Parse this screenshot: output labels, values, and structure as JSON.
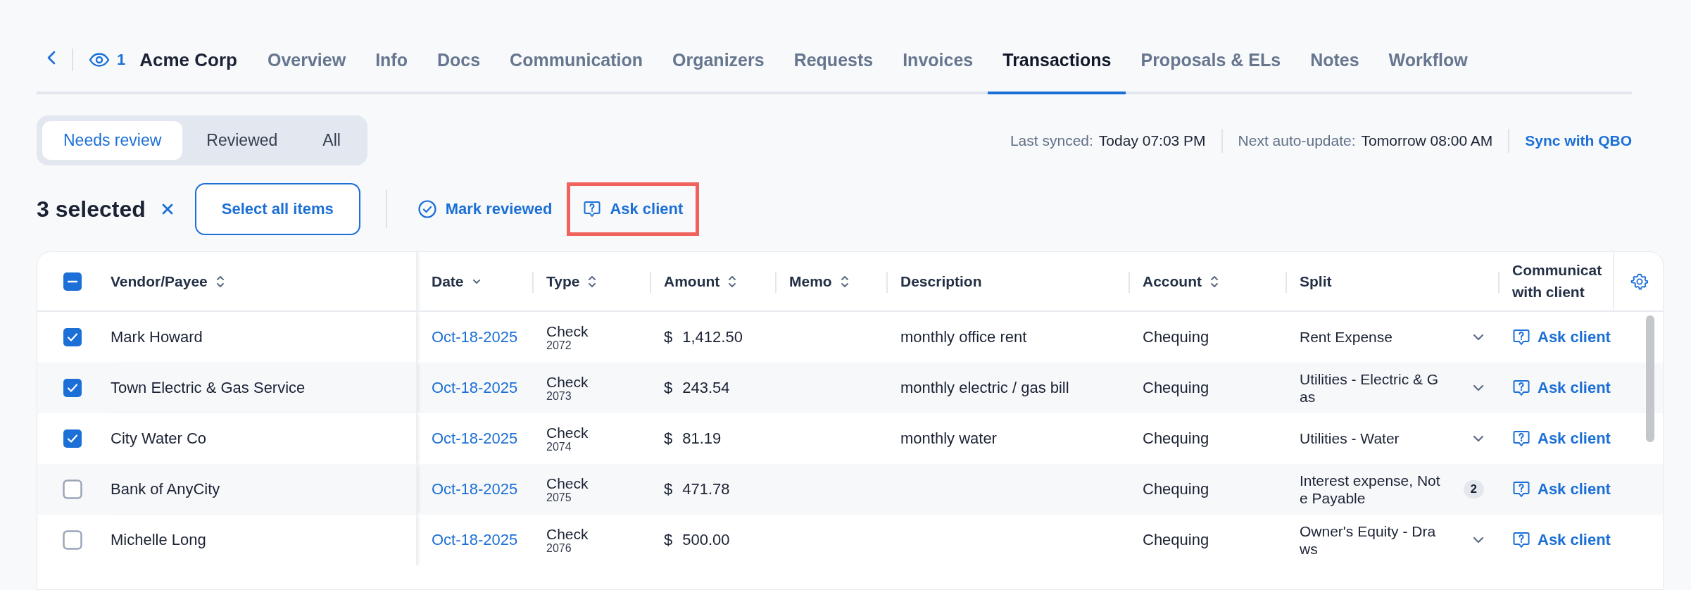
{
  "header": {
    "viewers": "1",
    "client_name": "Acme Corp"
  },
  "tabs": [
    {
      "label": "Overview",
      "selected": false
    },
    {
      "label": "Info",
      "selected": false
    },
    {
      "label": "Docs",
      "selected": false
    },
    {
      "label": "Communication",
      "selected": false
    },
    {
      "label": "Organizers",
      "selected": false
    },
    {
      "label": "Requests",
      "selected": false
    },
    {
      "label": "Invoices",
      "selected": false
    },
    {
      "label": "Transactions",
      "selected": true
    },
    {
      "label": "Proposals & ELs",
      "selected": false
    },
    {
      "label": "Notes",
      "selected": false
    },
    {
      "label": "Workflow",
      "selected": false
    }
  ],
  "filter": [
    {
      "label": "Needs review",
      "selected": true
    },
    {
      "label": "Reviewed",
      "selected": false
    },
    {
      "label": "All",
      "selected": false
    }
  ],
  "sync": {
    "last_label": "Last synced:",
    "last_value": "Today 07:03 PM",
    "next_label": "Next auto-update:",
    "next_value": "Tomorrow 08:00 AM",
    "action": "Sync with QBO"
  },
  "bulk": {
    "count_text": "3 selected",
    "select_all": "Select all items",
    "mark_reviewed": "Mark reviewed",
    "ask_client": "Ask client",
    "ask_client_highlighted": true
  },
  "table": {
    "header_checkbox_indeterminate": true,
    "columns": [
      {
        "label": "Vendor/Payee",
        "sortable": true,
        "sorted": false
      },
      {
        "label": "Date",
        "sortable": true,
        "sorted": true
      },
      {
        "label": "Type",
        "sortable": true,
        "sorted": false
      },
      {
        "label": "Amount",
        "sortable": true,
        "sorted": false
      },
      {
        "label": "Memo",
        "sortable": true,
        "sorted": false
      },
      {
        "label": "Description",
        "sortable": false
      },
      {
        "label": "Account",
        "sortable": true,
        "sorted": false
      },
      {
        "label": "Split",
        "sortable": false
      },
      {
        "label": "Communicat with client",
        "sortable": false
      }
    ],
    "rows": [
      {
        "checked": true,
        "vendor": "Mark Howard",
        "date": "Oct-18-2025",
        "type": "Check",
        "number": "2072",
        "currency": "$",
        "amount": "1,412.50",
        "description": "monthly office rent",
        "account": "Chequing",
        "split": {
          "kind": "single",
          "text": "Rent Expense"
        },
        "action": "Ask client"
      },
      {
        "checked": true,
        "vendor": "Town Electric & Gas Service",
        "date": "Oct-18-2025",
        "type": "Check",
        "number": "2073",
        "currency": "$",
        "amount": "243.54",
        "description": "monthly electric / gas bill",
        "account": "Chequing",
        "split": {
          "kind": "single",
          "text": "Utilities - Electric & Gas"
        },
        "action": "Ask client"
      },
      {
        "checked": true,
        "vendor": "City Water Co",
        "date": "Oct-18-2025",
        "type": "Check",
        "number": "2074",
        "currency": "$",
        "amount": "81.19",
        "description": "monthly water",
        "account": "Chequing",
        "split": {
          "kind": "single",
          "text": "Utilities - Water"
        },
        "action": "Ask client"
      },
      {
        "checked": false,
        "vendor": "Bank of AnyCity",
        "date": "Oct-18-2025",
        "type": "Check",
        "number": "2075",
        "currency": "$",
        "amount": "471.78",
        "account": "Chequing",
        "split": {
          "kind": "multi",
          "text": "Interest expense, Note Payable",
          "count": "2"
        },
        "action": "Ask client"
      },
      {
        "checked": false,
        "vendor": "Michelle Long",
        "date": "Oct-18-2025",
        "type": "Check",
        "number": "2076",
        "currency": "$",
        "amount": "500.00",
        "account": "Chequing",
        "split": {
          "kind": "single",
          "text": "Owner's Equity - Draws"
        },
        "action": "Ask client"
      }
    ]
  }
}
